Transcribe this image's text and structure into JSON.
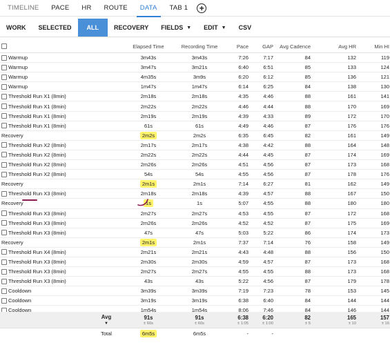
{
  "tabs": [
    {
      "label": "TIMELINE",
      "style": "muted"
    },
    {
      "label": "PACE",
      "style": ""
    },
    {
      "label": "HR",
      "style": ""
    },
    {
      "label": "ROUTE",
      "style": ""
    },
    {
      "label": "DATA",
      "style": "active"
    },
    {
      "label": "TAB 1",
      "style": ""
    }
  ],
  "add_tab_glyph": "+",
  "toolbar": {
    "work": "WORK",
    "selected": "SELECTED",
    "all": "ALL",
    "recovery": "RECOVERY",
    "fields": "FIELDS",
    "edit": "EDIT",
    "csv": "CSV",
    "caret": "▼"
  },
  "columns": {
    "elapsed": "Elapsed Time",
    "recording": "Recording Time",
    "pace": "Pace",
    "gap": "GAP",
    "cadence": "Avg Cadence",
    "avg_hr": "Avg HR",
    "min_hr": "Min HI"
  },
  "rows": [
    {
      "name": "Warmup",
      "cb": true,
      "elapsed": "3m43s",
      "recording": "3m43s",
      "pace": "7:26",
      "gap": "7:17",
      "cadence": "84",
      "avg_hr": "132",
      "min_hr": "119",
      "hl": false
    },
    {
      "name": "Warmup",
      "cb": true,
      "elapsed": "3m47s",
      "recording": "3m21s",
      "pace": "6:40",
      "gap": "6:51",
      "cadence": "85",
      "avg_hr": "133",
      "min_hr": "124",
      "hl": false
    },
    {
      "name": "Warmup",
      "cb": true,
      "elapsed": "4m35s",
      "recording": "3m9s",
      "pace": "6:20",
      "gap": "6:12",
      "cadence": "85",
      "avg_hr": "136",
      "min_hr": "121",
      "hl": false
    },
    {
      "name": "Warmup",
      "cb": true,
      "elapsed": "1m47s",
      "recording": "1m47s",
      "pace": "6:14",
      "gap": "6:25",
      "cadence": "84",
      "avg_hr": "138",
      "min_hr": "130",
      "hl": false
    },
    {
      "name": "Threshold Run X1 (8min)",
      "cb": true,
      "elapsed": "2m18s",
      "recording": "2m18s",
      "pace": "4:35",
      "gap": "4:46",
      "cadence": "88",
      "avg_hr": "161",
      "min_hr": "141",
      "hl": false
    },
    {
      "name": "Threshold Run X1 (8min)",
      "cb": true,
      "elapsed": "2m22s",
      "recording": "2m22s",
      "pace": "4:46",
      "gap": "4:44",
      "cadence": "88",
      "avg_hr": "170",
      "min_hr": "169",
      "hl": false
    },
    {
      "name": "Threshold Run X1 (8min)",
      "cb": true,
      "elapsed": "2m19s",
      "recording": "2m19s",
      "pace": "4:39",
      "gap": "4:33",
      "cadence": "89",
      "avg_hr": "172",
      "min_hr": "170",
      "hl": false
    },
    {
      "name": "Threshold Run X1 (8min)",
      "cb": true,
      "elapsed": "61s",
      "recording": "61s",
      "pace": "4:49",
      "gap": "4:46",
      "cadence": "87",
      "avg_hr": "176",
      "min_hr": "176",
      "hl": false
    },
    {
      "name": "Recovery",
      "cb": false,
      "elapsed": "2m2s",
      "recording": "2m2s",
      "pace": "6:35",
      "gap": "6:45",
      "cadence": "82",
      "avg_hr": "161",
      "min_hr": "149",
      "hl": true
    },
    {
      "name": "Threshold Run X2 (8min)",
      "cb": true,
      "elapsed": "2m17s",
      "recording": "2m17s",
      "pace": "4:38",
      "gap": "4:42",
      "cadence": "88",
      "avg_hr": "164",
      "min_hr": "148",
      "hl": false
    },
    {
      "name": "Threshold Run X2 (8min)",
      "cb": true,
      "elapsed": "2m22s",
      "recording": "2m22s",
      "pace": "4:44",
      "gap": "4:45",
      "cadence": "87",
      "avg_hr": "174",
      "min_hr": "169",
      "hl": false
    },
    {
      "name": "Threshold Run X2 (8min)",
      "cb": true,
      "elapsed": "2m26s",
      "recording": "2m26s",
      "pace": "4:51",
      "gap": "4:56",
      "cadence": "87",
      "avg_hr": "173",
      "min_hr": "168",
      "hl": false
    },
    {
      "name": "Threshold Run X2 (8min)",
      "cb": true,
      "elapsed": "54s",
      "recording": "54s",
      "pace": "4:55",
      "gap": "4:56",
      "cadence": "87",
      "avg_hr": "178",
      "min_hr": "176",
      "hl": false
    },
    {
      "name": "Recovery",
      "cb": false,
      "elapsed": "2m1s",
      "recording": "2m1s",
      "pace": "7:14",
      "gap": "6:27",
      "cadence": "81",
      "avg_hr": "162",
      "min_hr": "149",
      "hl": true
    },
    {
      "name": "Threshold Run X3 (8min)",
      "cb": true,
      "elapsed": "2m18s",
      "recording": "2m18s",
      "pace": "4:39",
      "gap": "4:57",
      "cadence": "88",
      "avg_hr": "167",
      "min_hr": "150",
      "hl": false
    },
    {
      "name": "Recovery",
      "cb": false,
      "elapsed": "1s",
      "recording": "1s",
      "pace": "5:07",
      "gap": "4:55",
      "cadence": "88",
      "avg_hr": "180",
      "min_hr": "180",
      "hl": true
    },
    {
      "name": "Threshold Run X3 (8min)",
      "cb": true,
      "elapsed": "2m27s",
      "recording": "2m27s",
      "pace": "4:53",
      "gap": "4:55",
      "cadence": "87",
      "avg_hr": "172",
      "min_hr": "168",
      "hl": false
    },
    {
      "name": "Threshold Run X3 (8min)",
      "cb": true,
      "elapsed": "2m26s",
      "recording": "2m26s",
      "pace": "4:52",
      "gap": "4:52",
      "cadence": "87",
      "avg_hr": "175",
      "min_hr": "169",
      "hl": false
    },
    {
      "name": "Threshold Run X3 (8min)",
      "cb": true,
      "elapsed": "47s",
      "recording": "47s",
      "pace": "5:03",
      "gap": "5:22",
      "cadence": "86",
      "avg_hr": "174",
      "min_hr": "173",
      "hl": false
    },
    {
      "name": "Recovery",
      "cb": false,
      "elapsed": "2m1s",
      "recording": "2m1s",
      "pace": "7:37",
      "gap": "7:14",
      "cadence": "76",
      "avg_hr": "158",
      "min_hr": "149",
      "hl": true
    },
    {
      "name": "Threshold Run X4 (8min)",
      "cb": true,
      "elapsed": "2m21s",
      "recording": "2m21s",
      "pace": "4:43",
      "gap": "4:48",
      "cadence": "88",
      "avg_hr": "156",
      "min_hr": "150",
      "hl": false
    },
    {
      "name": "Threshold Run X3 (8min)",
      "cb": true,
      "elapsed": "2m30s",
      "recording": "2m30s",
      "pace": "4:59",
      "gap": "4:57",
      "cadence": "87",
      "avg_hr": "173",
      "min_hr": "168",
      "hl": false
    },
    {
      "name": "Threshold Run X3 (8min)",
      "cb": true,
      "elapsed": "2m27s",
      "recording": "2m27s",
      "pace": "4:55",
      "gap": "4:55",
      "cadence": "88",
      "avg_hr": "173",
      "min_hr": "168",
      "hl": false
    },
    {
      "name": "Threshold Run X3 (8min)",
      "cb": true,
      "elapsed": "43s",
      "recording": "43s",
      "pace": "5:22",
      "gap": "4:56",
      "cadence": "87",
      "avg_hr": "179",
      "min_hr": "178",
      "hl": false
    },
    {
      "name": "Cooldown",
      "cb": true,
      "elapsed": "3m39s",
      "recording": "3m39s",
      "pace": "7:19",
      "gap": "7:23",
      "cadence": "78",
      "avg_hr": "153",
      "min_hr": "145",
      "hl": false
    },
    {
      "name": "Cooldown",
      "cb": true,
      "elapsed": "3m19s",
      "recording": "3m19s",
      "pace": "6:38",
      "gap": "6:40",
      "cadence": "84",
      "avg_hr": "144",
      "min_hr": "144",
      "hl": false
    },
    {
      "name": "Cooldown",
      "cb": true,
      "elapsed": "1m54s",
      "recording": "1m54s",
      "pace": "8:06",
      "gap": "7:46",
      "cadence": "84",
      "avg_hr": "146",
      "min_hr": "144",
      "hl": false
    }
  ],
  "summary": {
    "label": "Avg",
    "caret": "▼",
    "elapsed": {
      "v": "91s",
      "s": "± 60s"
    },
    "recording": {
      "v": "91s",
      "s": "± 60s"
    },
    "pace": {
      "v": "6:38",
      "s": "± 1:05"
    },
    "gap": {
      "v": "6:20",
      "s": "± 1:00"
    },
    "cadence": {
      "v": "82",
      "s": "± 5"
    },
    "avg_hr": {
      "v": "165",
      "s": "± 10"
    },
    "min_hr": {
      "v": "157",
      "s": "± 16"
    }
  },
  "total": {
    "label": "Total",
    "elapsed": "6m5s",
    "recording": "6m5s",
    "pace": "-",
    "gap": "-"
  },
  "highlight_color": "#fff36b",
  "annotation_color": "#8a1a4f"
}
